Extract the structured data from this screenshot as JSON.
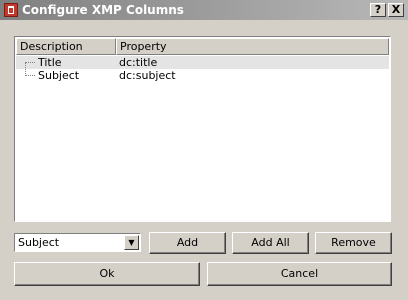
{
  "window": {
    "title": "Configure XMP Columns",
    "help_label": "?",
    "close_label": "X"
  },
  "table": {
    "columns": [
      "Description",
      "Property"
    ],
    "rows": [
      {
        "description": "Title",
        "property": "dc:title"
      },
      {
        "description": "Subject",
        "property": "dc:subject"
      }
    ]
  },
  "combo": {
    "selected": "Subject",
    "arrow_icon": "▼"
  },
  "buttons": {
    "add": "Add",
    "add_all": "Add All",
    "remove": "Remove",
    "ok": "Ok",
    "cancel": "Cancel"
  }
}
